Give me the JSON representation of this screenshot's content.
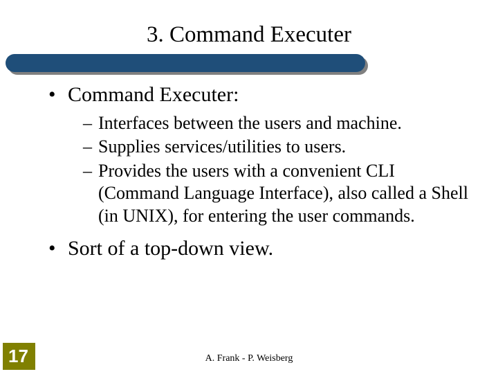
{
  "title": "3. Command Executer",
  "bullets": {
    "b1": "Command Executer:",
    "b1_subs": {
      "s1": "Interfaces between the users and machine.",
      "s2": "Supplies services/utilities to users.",
      "s3": "Provides the users with a convenient CLI (Command Language Interface), also called a Shell (in UNIX), for entering the user commands."
    },
    "b2": "Sort of a top-down view."
  },
  "page_number": "17",
  "footer": "A. Frank - P. Weisberg",
  "colors": {
    "bar": "#1f4e79",
    "page_badge": "#808000"
  }
}
